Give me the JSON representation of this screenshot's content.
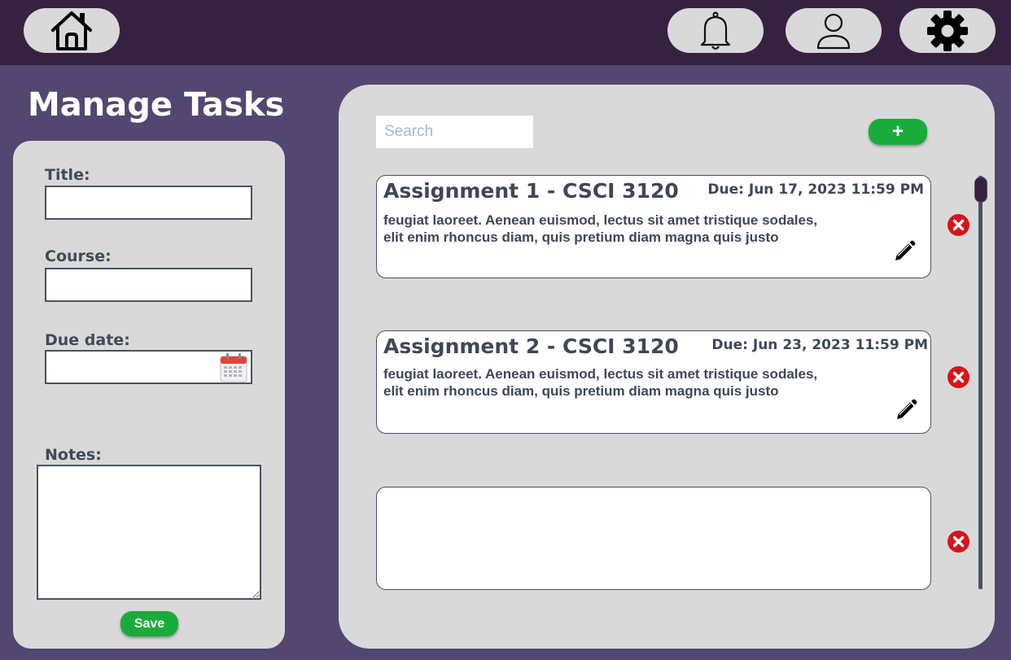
{
  "nav": {
    "home_icon": "home-icon",
    "bell_icon": "bell-icon",
    "user_icon": "user-icon",
    "gear_icon": "gear-icon"
  },
  "page": {
    "title": "Manage Tasks"
  },
  "form": {
    "title_label": "Title:",
    "course_label": "Course:",
    "due_label": "Due date:",
    "notes_label": "Notes:",
    "save_label": "Save",
    "title_value": "",
    "course_value": "",
    "due_value": "",
    "notes_value": ""
  },
  "list": {
    "search_placeholder": "Search",
    "add_label": "+",
    "tasks": [
      {
        "title": "Assignment 1 - CSCI 3120",
        "due": "Due: Jun 17, 2023 11:59 PM",
        "desc_line1": "feugiat laoreet. Aenean euismod, lectus sit amet tristique sodales,",
        "desc_line2": "elit enim rhoncus diam, quis pretium diam magna quis justo"
      },
      {
        "title": "Assignment 2 - CSCI 3120",
        "due": "Due: Jun 23, 2023 11:59 PM",
        "desc_line1": "feugiat laoreet. Aenean euismod, lectus sit amet tristique sodales,",
        "desc_line2": "elit enim rhoncus diam, quis pretium diam magna quis justo"
      },
      {
        "title": "",
        "due": "",
        "desc_line1": "",
        "desc_line2": ""
      }
    ]
  },
  "colors": {
    "background": "#534670",
    "topbar": "#372141",
    "panel": "#d9d9d9",
    "accent_green": "#1aac3b",
    "delete_red": "#d7141a",
    "text_dark": "#3f4758"
  }
}
